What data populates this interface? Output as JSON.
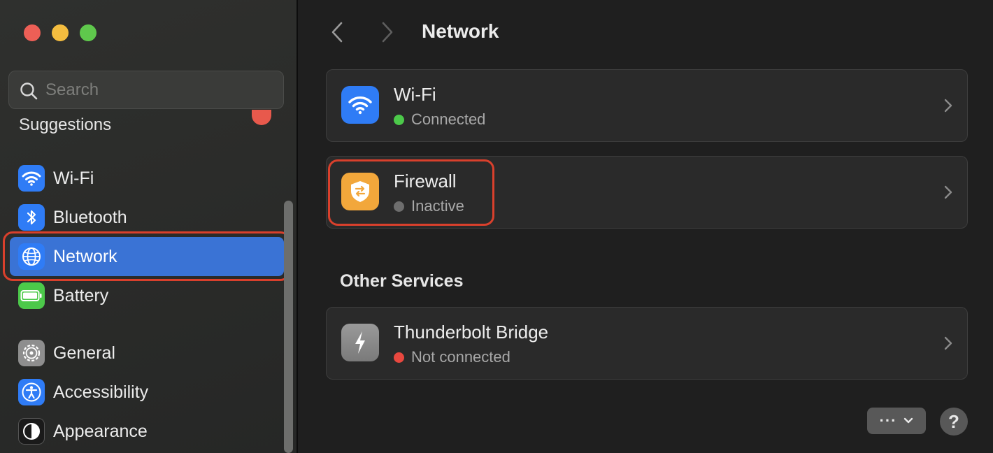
{
  "window": {
    "controls": [
      "close",
      "minimize",
      "zoom"
    ]
  },
  "sidebar": {
    "search": {
      "placeholder": "Search",
      "value": ""
    },
    "suggestions_heading": "Suggestions",
    "items": [
      {
        "label": "Wi-Fi",
        "icon": "wifi-icon",
        "icon_bg": "#2f7cf6",
        "selected": false
      },
      {
        "label": "Bluetooth",
        "icon": "bluetooth-icon",
        "icon_bg": "#2f7cf6",
        "selected": false
      },
      {
        "label": "Network",
        "icon": "globe-icon",
        "icon_bg": "#2f7cf6",
        "selected": true
      },
      {
        "label": "Battery",
        "icon": "battery-icon",
        "icon_bg": "#4cc94a",
        "selected": false
      },
      {
        "label": "General",
        "icon": "gear-icon",
        "icon_bg": "#8e8e8e",
        "selected": false
      },
      {
        "label": "Accessibility",
        "icon": "accessibility-icon",
        "icon_bg": "#2f7cf6",
        "selected": false
      },
      {
        "label": "Appearance",
        "icon": "appearance-icon",
        "icon_bg": "#1a1a1a",
        "selected": false
      }
    ]
  },
  "main": {
    "title": "Network",
    "services": [
      {
        "title": "Wi-Fi",
        "status": "Connected",
        "status_color": "#4cc94a",
        "icon": "wifi-icon",
        "icon_bg": "#2f7cf6"
      },
      {
        "title": "Firewall",
        "status": "Inactive",
        "status_color": "#6e6e6e",
        "icon": "shield-icon",
        "icon_bg": "#f2a73b"
      }
    ],
    "other_services_heading": "Other Services",
    "other_services": [
      {
        "title": "Thunderbolt Bridge",
        "status": "Not connected",
        "status_color": "#e8483f",
        "icon": "thunderbolt-icon",
        "icon_bg": "#8a8a8a"
      }
    ],
    "more_button": "···",
    "help_button": "?"
  },
  "colors": {
    "accent_selection": "#3a73d5",
    "highlight_annotation": "#d9402c"
  }
}
